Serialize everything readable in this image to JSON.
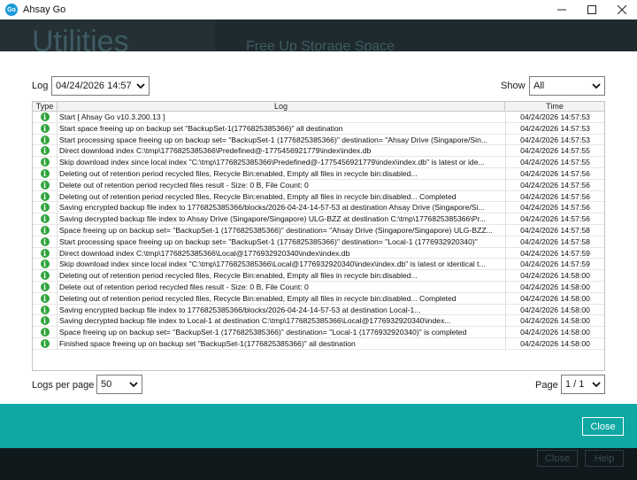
{
  "window": {
    "app_icon_text": "Go",
    "title": "Ahsay Go",
    "minimize_icon": "minimize-icon",
    "maximize_icon": "maximize-icon",
    "close_icon": "close-icon"
  },
  "background": {
    "page_title": "Utilities",
    "section_title": "Free Up Storage Space",
    "close_label": "Close",
    "help_label": "Help"
  },
  "filters": {
    "log_label": "Log",
    "log_value": "04/24/2026 14:57",
    "show_label": "Show",
    "show_value": "All"
  },
  "table": {
    "columns": [
      "Type",
      "Log",
      "Time"
    ],
    "rows": [
      {
        "type": "info",
        "log": "Start [ Ahsay Go v10.3.200.13 ]",
        "time": "04/24/2026 14:57:53"
      },
      {
        "type": "info",
        "log": "Start space freeing up on backup set \"BackupSet-1(1776825385366)\" all destination",
        "time": "04/24/2026 14:57:53"
      },
      {
        "type": "info",
        "log": "Start processing space freeing up on backup set= \"BackupSet-1 (1776825385366)\" destination= \"Ahsay Drive (Singapore/Sin...",
        "time": "04/24/2026 14:57:53"
      },
      {
        "type": "info",
        "log": "Direct download index C:\\tmp\\1776825385366\\Predefined@-1775456921779\\index\\index.db",
        "time": "04/24/2026 14:57:55"
      },
      {
        "type": "info",
        "log": "Skip download index since local index \"C:\\tmp\\1776825385366\\Predefined@-1775456921779\\index\\index.db\" is latest or ide...",
        "time": "04/24/2026 14:57:55"
      },
      {
        "type": "info",
        "log": "Deleting out of retention period recycled files, Recycle Bin:enabled, Empty all files in recycle bin:disabled...",
        "time": "04/24/2026 14:57:56"
      },
      {
        "type": "info",
        "log": "Delete out of retention period recycled files result - Size: 0 B, File Count: 0",
        "time": "04/24/2026 14:57:56"
      },
      {
        "type": "info",
        "log": "Deleting out of retention period recycled files, Recycle Bin:enabled, Empty all files in recycle bin:disabled... Completed",
        "time": "04/24/2026 14:57:56"
      },
      {
        "type": "info",
        "log": "Saving encrypted backup file index to 1776825385366/blocks/2026-04-24-14-57-53 at destination Ahsay Drive (Singapore/Si...",
        "time": "04/24/2026 14:57:56"
      },
      {
        "type": "info",
        "log": "Saving decrypted backup file index to Ahsay Drive (Singapore/Singapore) ULG-BZZ at destination C:\\tmp\\1776825385366\\Pr...",
        "time": "04/24/2026 14:57:56"
      },
      {
        "type": "info",
        "log": "Space freeing up on backup set= \"BackupSet-1 (1776825385366)\" destination= \"Ahsay Drive (Singapore/Singapore) ULG-BZZ...",
        "time": "04/24/2026 14:57:58"
      },
      {
        "type": "info",
        "log": "Start processing space freeing up on backup set= \"BackupSet-1 (1776825385366)\" destination= \"Local-1 (1776932920340)\"",
        "time": "04/24/2026 14:57:58"
      },
      {
        "type": "info",
        "log": "Direct download index C:\\tmp\\1776825385366\\Local@1776932920340\\index\\index.db",
        "time": "04/24/2026 14:57:59"
      },
      {
        "type": "info",
        "log": "Skip download index since local index \"C:\\tmp\\1776825385366\\Local@1776932920340\\index\\index.db\" is latest or identical t...",
        "time": "04/24/2026 14:57:59"
      },
      {
        "type": "info",
        "log": "Deleting out of retention period recycled files, Recycle Bin:enabled, Empty all files in recycle bin:disabled...",
        "time": "04/24/2026 14:58:00"
      },
      {
        "type": "info",
        "log": "Delete out of retention period recycled files result - Size: 0 B, File Count: 0",
        "time": "04/24/2026 14:58:00"
      },
      {
        "type": "info",
        "log": "Deleting out of retention period recycled files, Recycle Bin:enabled, Empty all files in recycle bin:disabled... Completed",
        "time": "04/24/2026 14:58:00"
      },
      {
        "type": "info",
        "log": "Saving encrypted backup file index to 1776825385366/blocks/2026-04-24-14-57-53 at destination Local-1...",
        "time": "04/24/2026 14:58:00"
      },
      {
        "type": "info",
        "log": "Saving decrypted backup file index to Local-1 at destination C:\\tmp\\1776825385366\\Local@1776932920340\\index...",
        "time": "04/24/2026 14:58:00"
      },
      {
        "type": "info",
        "log": "Space freeing up on backup set= \"BackupSet-1 (1776825385366)\" destination= \"Local-1 (1776932920340)\" is completed",
        "time": "04/24/2026 14:58:00"
      },
      {
        "type": "info",
        "log": "Finished space freeing up on backup set \"BackupSet-1(1776825385366)\" all destination",
        "time": "04/24/2026 14:58:00"
      }
    ]
  },
  "pagination": {
    "per_page_label": "Logs per page",
    "per_page_value": "50",
    "page_label": "Page",
    "page_value": "1 / 1"
  },
  "footer": {
    "close_label": "Close",
    "accent_color": "#0fa8a3"
  },
  "icons": {
    "row_type_icon": "info-icon",
    "dropdown_icon": "chevron-down-icon"
  }
}
